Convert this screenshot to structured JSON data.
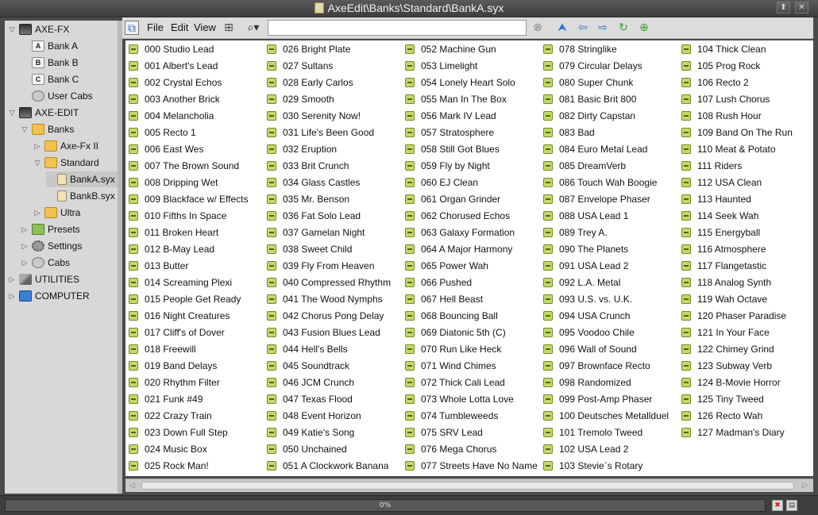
{
  "window": {
    "title": "AxeEdit\\Banks\\Standard\\BankA.syx",
    "pin_label": "⬆",
    "close_label": "✕"
  },
  "tree": [
    {
      "label": "AXE-FX",
      "icon": "device-icon",
      "level": 0,
      "expanded": true
    },
    {
      "label": "Bank A",
      "icon": "bank-a-icon",
      "level": 1
    },
    {
      "label": "Bank B",
      "icon": "bank-b-icon",
      "level": 1
    },
    {
      "label": "Bank C",
      "icon": "bank-c-icon",
      "level": 1
    },
    {
      "label": "User Cabs",
      "icon": "cabs-icon",
      "level": 1
    },
    {
      "label": "AXE-EDIT",
      "icon": "device-icon",
      "level": 0,
      "expanded": true
    },
    {
      "label": "Banks",
      "icon": "folder-icon",
      "level": 1,
      "expanded": true
    },
    {
      "label": "Axe-Fx II",
      "icon": "folder-icon",
      "level": 2,
      "expanded": false
    },
    {
      "label": "Standard",
      "icon": "folder-icon",
      "level": 2,
      "expanded": true
    },
    {
      "label": "BankA.syx",
      "icon": "file-icon",
      "level": 3,
      "selected": true
    },
    {
      "label": "BankB.syx",
      "icon": "file-icon",
      "level": 3
    },
    {
      "label": "Ultra",
      "icon": "folder-icon",
      "level": 2,
      "expanded": false
    },
    {
      "label": "Presets",
      "icon": "presets-icon",
      "level": 1,
      "expanded": false
    },
    {
      "label": "Settings",
      "icon": "gear-icon",
      "level": 1,
      "expanded": false
    },
    {
      "label": "Cabs",
      "icon": "cabs-icon",
      "level": 1,
      "expanded": false
    },
    {
      "label": "UTILITIES",
      "icon": "tools-icon",
      "level": 0,
      "expanded": false
    },
    {
      "label": "COMPUTER",
      "icon": "computer-icon",
      "level": 0,
      "expanded": false
    }
  ],
  "toolbar": {
    "file": "File",
    "edit": "Edit",
    "view": "View",
    "search_value": ""
  },
  "presets": [
    [
      "000 Studio Lead",
      "001 Albert's Lead",
      "002 Crystal Echos",
      "003 Another Brick",
      "004 Melancholia",
      "005 Recto 1",
      "006 East Wes",
      "007 The Brown Sound",
      "008 Dripping Wet",
      "009 Blackface w/ Effects",
      "010 Fifths In Space",
      "011 Broken Heart",
      "012 B-May Lead",
      "013 Butter",
      "014 Screaming Plexi",
      "015 People Get Ready",
      "016 Night Creatures",
      "017 Cliff's of Dover",
      "018 Freewill",
      "019 Band Delays",
      "020 Rhythm Filter",
      "021 Funk #49",
      "022 Crazy Train",
      "023 Down Full Step",
      "024 Music Box",
      "025 Rock Man!"
    ],
    [
      "026 Bright Plate",
      "027 Sultans",
      "028 Early Carlos",
      "029 Smooth",
      "030 Serenity Now!",
      "031 Life's Been Good",
      "032 Eruption",
      "033 Brit Crunch",
      "034 Glass Castles",
      "035 Mr. Benson",
      "036 Fat Solo Lead",
      "037 Gamelan Night",
      "038 Sweet Child",
      "039 Fly From Heaven",
      "040 Compressed Rhythm",
      "041 The Wood Nymphs",
      "042 Chorus Pong Delay",
      "043 Fusion Blues Lead",
      "044 Hell's Bells",
      "045 Soundtrack",
      "046 JCM Crunch",
      "047 Texas Flood",
      "048 Event Horizon",
      "049 Katie's Song",
      "050 Unchained",
      "051 A Clockwork Banana"
    ],
    [
      "052 Machine Gun",
      "053 Limelight",
      "054 Lonely Heart Solo",
      "055 Man In The Box",
      "056 Mark IV Lead",
      "057 Stratosphere",
      "058 Still Got Blues",
      "059 Fly by Night",
      "060 EJ Clean",
      "061 Organ Grinder",
      "062 Chorused Echos",
      "063 Galaxy Formation",
      "064 A Major Harmony",
      "065 Power Wah",
      "066 Pushed",
      "067 Hell Beast",
      "068 Bouncing Ball",
      "069 Diatonic 5th (C)",
      "070 Run Like Heck",
      "071 Wind Chimes",
      "072 Thick Cali Lead",
      "073 Whole Lotta Love",
      "074 Tumbleweeds",
      "075 SRV Lead",
      "076 Mega Chorus",
      "077 Streets Have No Name"
    ],
    [
      "078 Stringlike",
      "079 Circular Delays",
      "080 Super Chunk",
      "081 Basic Brit 800",
      "082 Dirty Capstan",
      "083 Bad",
      "084 Euro Metal Lead",
      "085 DreamVerb",
      "086 Touch Wah Boogie",
      "087 Envelope Phaser",
      "088 USA Lead 1",
      "089 Trey A.",
      "090 The Planets",
      "091 USA Lead 2",
      "092 L.A. Metal",
      "093 U.S. vs. U.K.",
      "094 USA Crunch",
      "095 Voodoo Chile",
      "096 Wall of Sound",
      "097 Brownface Recto",
      "098 Randomized",
      "099 Post-Amp Phaser",
      "100 Deutsches Metallduel",
      "101 Tremolo Tweed",
      "102 USA Lead 2",
      "103 Stevie`s Rotary"
    ],
    [
      "104 Thick Clean",
      "105 Prog Rock",
      "106 Recto 2",
      "107 Lush Chorus",
      "108 Rush Hour",
      "109 Band On The Run",
      "110 Meat & Potato",
      "111 Riders",
      "112 USA Clean",
      "113 Haunted",
      "114 Seek Wah",
      "115 Energyball",
      "116 Atmosphere",
      "117 Flangetastic",
      "118 Analog Synth",
      "119 Wah Octave",
      "120 Phaser Paradise",
      "121 In Your Face",
      "122 Chimey Grind",
      "123 Subway Verb",
      "124 B-Movie Horror",
      "125 Tiny Tweed",
      "126 Recto Wah",
      "127 Madman's Diary"
    ]
  ],
  "status": {
    "progress_text": "0%",
    "progress": 0
  }
}
